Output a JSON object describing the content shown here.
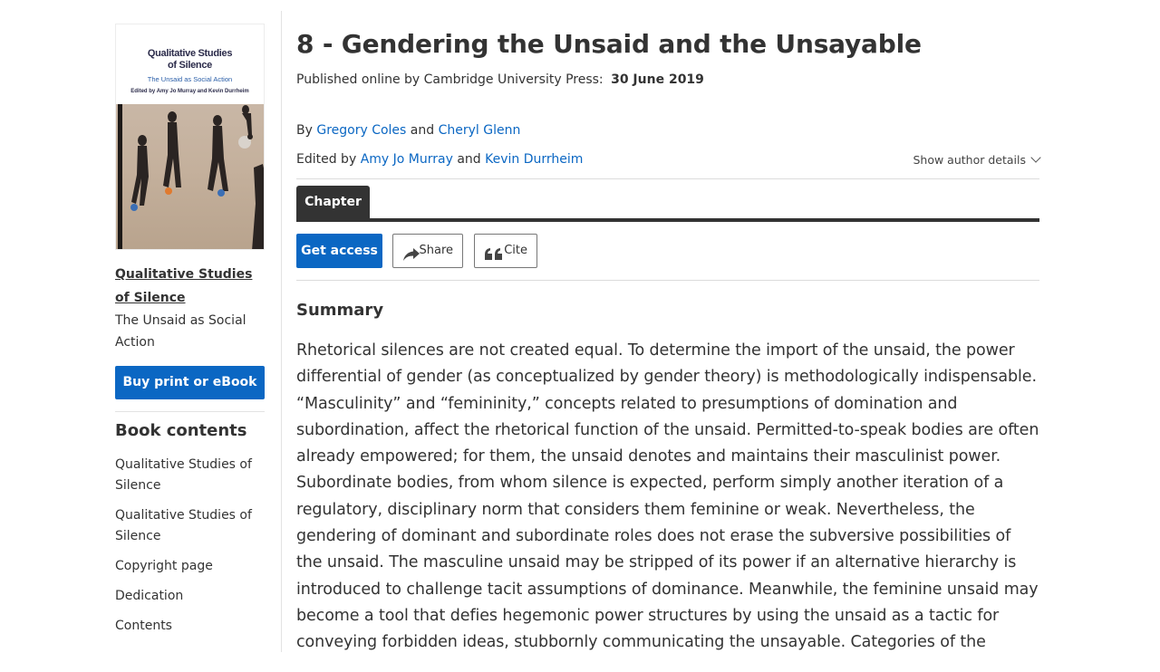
{
  "sidebar": {
    "cover": {
      "title_line1": "Qualitative Studies",
      "title_line2": "of Silence",
      "subtitle": "The Unsaid as Social Action",
      "editors": "Edited by Amy Jo Murray and Kevin Durrheim"
    },
    "book_title": "Qualitative Studies of Silence",
    "book_subtitle": "The Unsaid as Social Action",
    "buy_label": "Buy print or eBook",
    "contents_heading": "Book contents",
    "toc": [
      "Qualitative Studies of Silence",
      "Qualitative Studies of Silence",
      "Copyright page",
      "Dedication",
      "Contents"
    ]
  },
  "main": {
    "title": "8 - Gendering the Unsaid and the Unsayable",
    "published_prefix": "Published online by Cambridge University Press:",
    "published_date": "30 June 2019",
    "by_label": "By",
    "authors": [
      "Gregory Coles",
      "Cheryl Glenn"
    ],
    "and_label": "and",
    "edited_label": "Edited by",
    "editors": [
      "Amy Jo Murray",
      "Kevin Durrheim"
    ],
    "author_details_label": "Show author details",
    "tab_label": "Chapter",
    "get_access_label": "Get access",
    "share_label": "Share",
    "cite_label": "Cite",
    "summary_heading": "Summary",
    "summary_text": "Rhetorical silences are not created equal. To determine the import of the unsaid, the power differential of gender (as conceptualized by gender theory) is methodologically indispensable. “Masculinity” and “femininity,” concepts related to presumptions of domination and subordination, affect the rhetorical function of the unsaid. Permitted-to-speak bodies are often already empowered; for them, the unsaid denotes and maintains their masculinist power. Subordinate bodies, from whom silence is expected, perform simply another iteration of a regulatory, disciplinary norm that considers them feminine or weak. Nevertheless, the gendering of dominant and subordinate roles does not erase the subversive possibilities of the unsaid. The masculine unsaid may be stripped of its power if an alternative hierarchy is introduced to challenge tacit assumptions of dominance. Meanwhile, the feminine unsaid may become a tool that defies hegemonic power structures by using the unsaid as a tactic for conveying forbidden ideas, stubbornly communicating the unsayable. Categories of the"
  },
  "colors": {
    "link": "#0b67c3",
    "primary_button": "#0b67c3",
    "tab_dark": "#333333",
    "text": "#333333"
  },
  "icons": {
    "share": "share-arrow-icon",
    "cite": "quote-icon",
    "author_details": "chevron-down-icon"
  }
}
